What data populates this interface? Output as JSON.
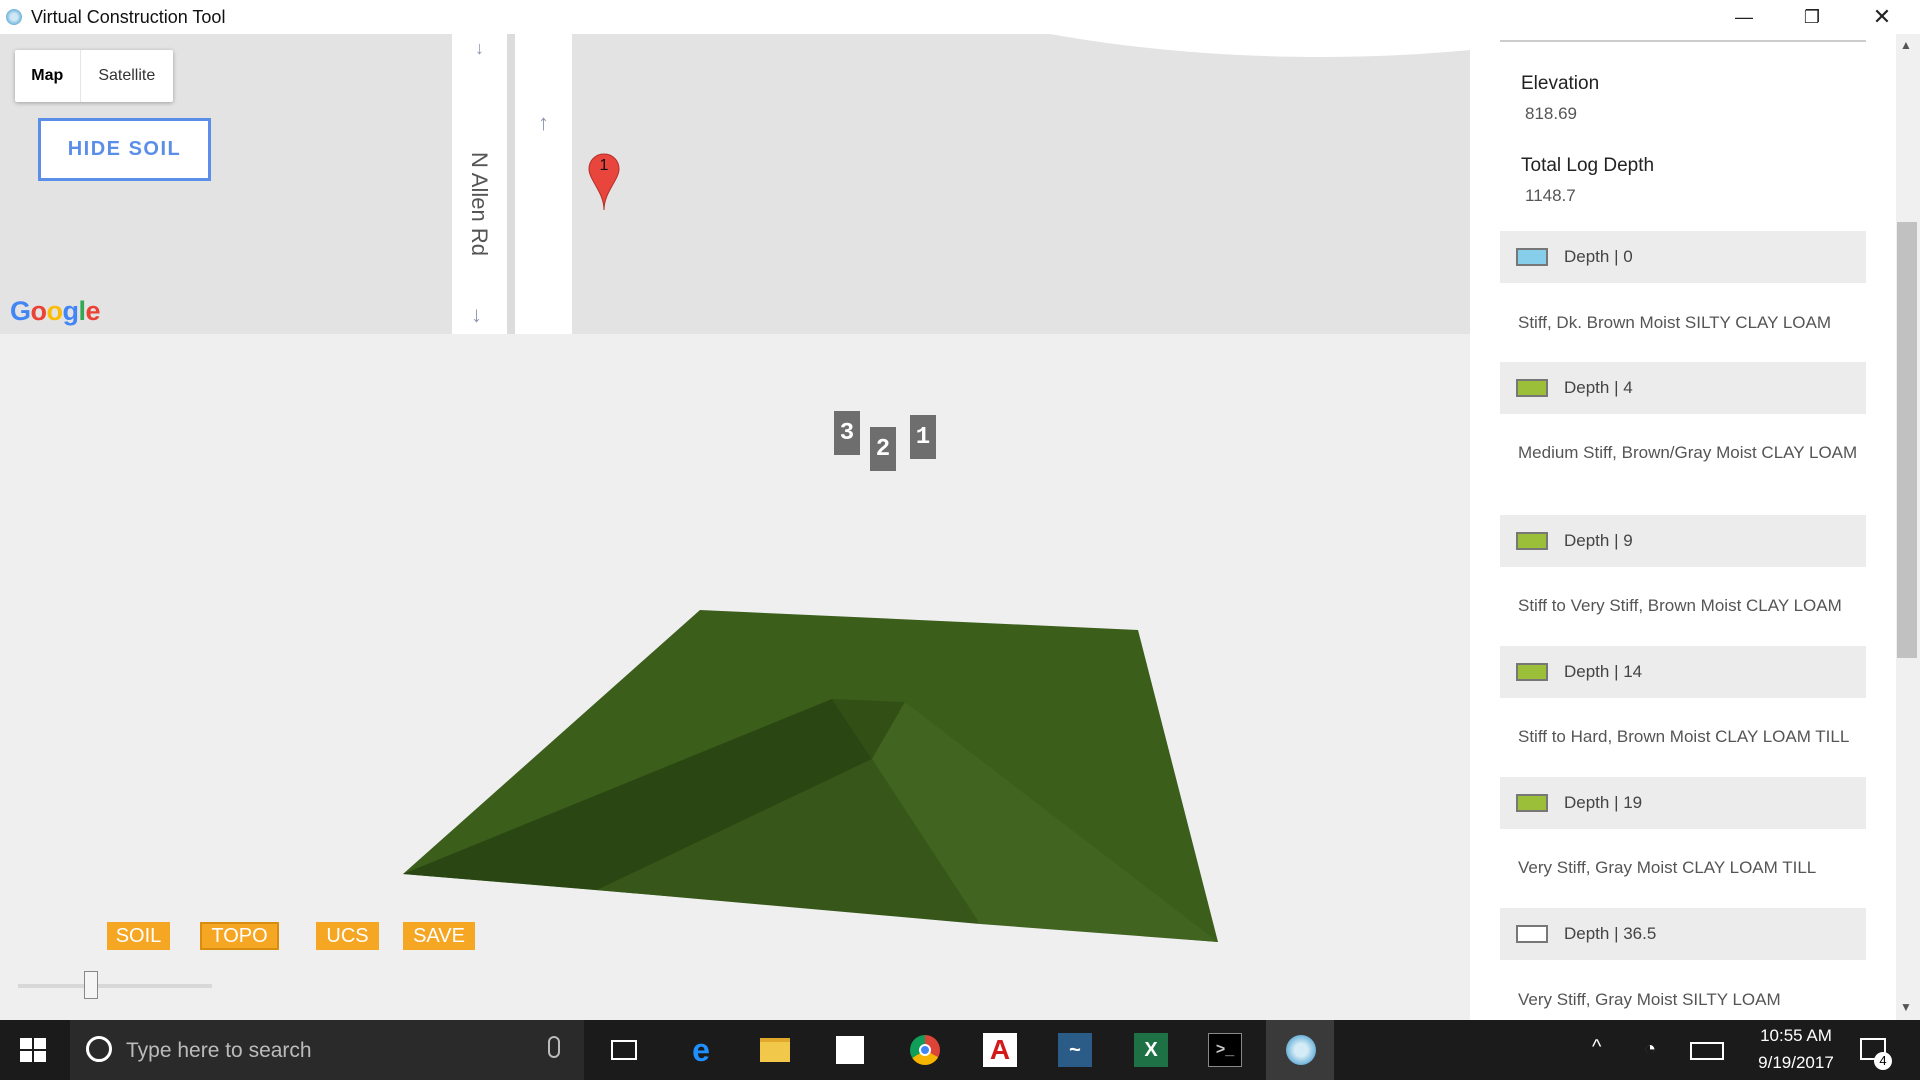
{
  "window": {
    "title": "Virtual Construction Tool",
    "minimize": "—",
    "restore": "❐",
    "close": "✕"
  },
  "map": {
    "types": [
      "Map",
      "Satellite"
    ],
    "hide_soil": "HIDE SOIL",
    "road_name": "N Allen Rd",
    "marker_label": "1",
    "google": [
      "G",
      "o",
      "o",
      "g",
      "l",
      "e"
    ]
  },
  "viewport": {
    "borings": [
      "3",
      "2",
      "1"
    ],
    "tools": [
      "SOIL",
      "TOPO",
      "UCS",
      "SAVE"
    ]
  },
  "panel": {
    "elevation_label": "Elevation",
    "elevation_value": "818.69",
    "log_depth_label": "Total Log Depth",
    "log_depth_value": "1148.7",
    "layers": [
      {
        "depth": "Depth | 0",
        "color": "#87ceeb",
        "desc": "Stiff, Dk. Brown Moist SILTY CLAY LOAM"
      },
      {
        "depth": "Depth | 4",
        "color": "#9cbf3a",
        "desc": "Medium Stiff, Brown/Gray Moist CLAY LOAM"
      },
      {
        "depth": "Depth | 9",
        "color": "#9cbf3a",
        "desc": "Stiff to Very Stiff, Brown Moist CLAY LOAM"
      },
      {
        "depth": "Depth | 14",
        "color": "#9cbf3a",
        "desc": "Stiff to Hard, Brown Moist CLAY LOAM TILL"
      },
      {
        "depth": "Depth | 19",
        "color": "#9cbf3a",
        "desc": "Very Stiff, Gray Moist CLAY LOAM TILL"
      },
      {
        "depth": "Depth | 36.5",
        "color": "#ffffff",
        "desc": "Very Stiff, Gray Moist SILTY LOAM"
      }
    ]
  },
  "taskbar": {
    "search_placeholder": "Type here to search",
    "time": "10:55 AM",
    "date": "9/19/2017",
    "notification_count": "4",
    "apps": [
      "task-view",
      "edge",
      "file-explorer",
      "store",
      "chrome",
      "adobe",
      "mysql",
      "excel",
      "terminal",
      "virtual-construction-tool"
    ]
  },
  "colors": {
    "terrain": "#3a5e1c",
    "accent": "#f5a623",
    "map_button": "#5b8ee8"
  }
}
